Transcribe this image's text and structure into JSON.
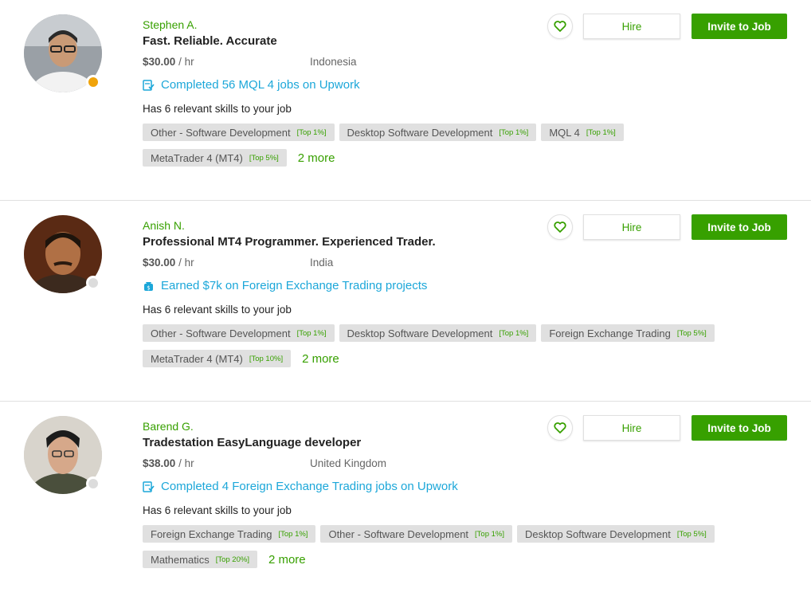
{
  "colors": {
    "accent_green": "#37a000",
    "link_blue": "#1ca7d9",
    "tag_bg": "#e0e0e0",
    "status_away": "#f0a30a",
    "status_offline": "#dcdcdc"
  },
  "freelancers": [
    {
      "name": "Stephen A.",
      "title": "Fast. Reliable. Accurate",
      "rate": "$30.00",
      "rate_unit": "/ hr",
      "country": "Indonesia",
      "status": "away",
      "achievement_icon": "completed-jobs-icon",
      "achievement": "Completed 56 MQL 4 jobs on Upwork",
      "skills_prefix": "Has ",
      "skills_count": "6 relevant skills",
      "skills_suffix": " to your job",
      "tag_rows": [
        [
          {
            "label": "Other - Software Development",
            "rank": "[Top 1%]"
          },
          {
            "label": "Desktop Software Development",
            "rank": "[Top 1%]"
          },
          {
            "label": "MQL 4",
            "rank": "[Top 1%]"
          }
        ],
        [
          {
            "label": "MetaTrader 4 (MT4)",
            "rank": "[Top 5%]"
          }
        ]
      ],
      "more": "2 more",
      "hire_label": "Hire",
      "invite_label": "Invite to Job"
    },
    {
      "name": "Anish N.",
      "title": "Professional MT4 Programmer. Experienced Trader.",
      "rate": "$30.00",
      "rate_unit": "/ hr",
      "country": "India",
      "status": "offline",
      "achievement_icon": "earnings-icon",
      "achievement": "Earned $7k on Foreign Exchange Trading projects",
      "skills_prefix": "Has ",
      "skills_count": "6 relevant skills",
      "skills_suffix": " to your job",
      "tag_rows": [
        [
          {
            "label": "Other - Software Development",
            "rank": "[Top 1%]"
          },
          {
            "label": "Desktop Software Development",
            "rank": "[Top 1%]"
          },
          {
            "label": "Foreign Exchange Trading",
            "rank": "[Top 5%]"
          }
        ],
        [
          {
            "label": "MetaTrader 4 (MT4)",
            "rank": "[Top 10%]"
          }
        ]
      ],
      "more": "2 more",
      "hire_label": "Hire",
      "invite_label": "Invite to Job"
    },
    {
      "name": "Barend G.",
      "title": "Tradestation EasyLanguage developer",
      "rate": "$38.00",
      "rate_unit": "/ hr",
      "country": "United Kingdom",
      "status": "offline",
      "achievement_icon": "completed-jobs-icon",
      "achievement": "Completed 4 Foreign Exchange Trading jobs on Upwork",
      "skills_prefix": "Has ",
      "skills_count": "6 relevant skills",
      "skills_suffix": " to your job",
      "tag_rows": [
        [
          {
            "label": "Foreign Exchange Trading",
            "rank": "[Top 1%]"
          },
          {
            "label": "Other - Software Development",
            "rank": "[Top 1%]"
          },
          {
            "label": "Desktop Software Development",
            "rank": "[Top 5%]"
          }
        ],
        [
          {
            "label": "Mathematics",
            "rank": "[Top 20%]"
          }
        ]
      ],
      "more": "2 more",
      "hire_label": "Hire",
      "invite_label": "Invite to Job"
    }
  ]
}
